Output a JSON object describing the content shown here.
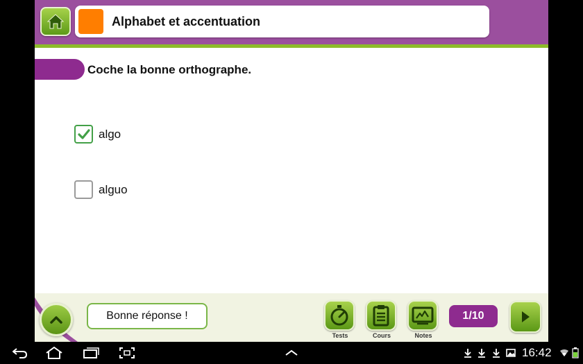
{
  "header": {
    "title": "Alphabet et accentuation",
    "home_icon": "home-icon",
    "accent_color": "#9b4f9e",
    "swatch_color": "#ff7e00"
  },
  "question": {
    "text": "Coche la bonne orthographe."
  },
  "options": [
    {
      "label": "algo",
      "checked": true
    },
    {
      "label": "alguo",
      "checked": false
    }
  ],
  "footer": {
    "feedback": "Bonne réponse !",
    "tools": [
      {
        "label": "Tests",
        "icon": "stopwatch-icon"
      },
      {
        "label": "Cours",
        "icon": "clipboard-icon"
      },
      {
        "label": "Notes",
        "icon": "notes-icon"
      }
    ],
    "counter": "1/10",
    "up_icon": "chevron-up-icon",
    "next_icon": "play-right-icon"
  },
  "system_bar": {
    "time": "16:42",
    "nav_icons": [
      "back-icon",
      "home-icon",
      "recent-apps-icon",
      "screenshot-icon",
      "chevron-up-icon"
    ],
    "status_icons": [
      "download-icon",
      "download-icon",
      "download-icon",
      "image-icon",
      "wifi-icon",
      "battery-icon"
    ]
  }
}
